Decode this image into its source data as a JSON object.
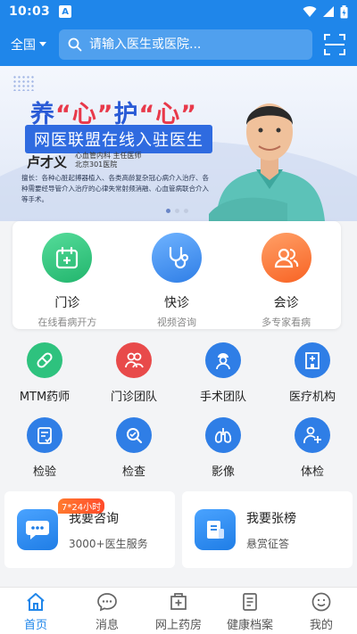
{
  "status": {
    "time": "10:03",
    "app_badge": "A"
  },
  "header": {
    "region": "全国",
    "search_placeholder": "请输入医生或医院..."
  },
  "banner": {
    "headline_pre": "养",
    "headline_q1": "“心”",
    "headline_mid": "护",
    "headline_q2": "“心”",
    "subline": "网医联盟在线入驻医生",
    "doctor_name": "卢才义",
    "doctor_title_1": "心血管内科  主任医师",
    "doctor_title_2": "北京301医院",
    "description": "擅长：各种心脏起搏器植入、各类高龄复杂冠心病介入治疗、各种需要经导管介入治疗的心律失常射频消融、心血管病联合介入等手术。",
    "slide_count": 3,
    "active_slide": 1
  },
  "quick_services": [
    {
      "title": "门诊",
      "sub": "在线看病开方",
      "icon": "calendar-plus-icon",
      "color": "#2ec27e"
    },
    {
      "title": "快诊",
      "sub": "视频咨询",
      "icon": "stethoscope-icon",
      "color": "#2f8bee"
    },
    {
      "title": "会诊",
      "sub": "多专家看病",
      "icon": "group-icon",
      "color": "#ff7a3c"
    }
  ],
  "functions": [
    {
      "label": "MTM药师",
      "icon": "pill-icon",
      "color": "#2ec27e"
    },
    {
      "label": "门诊团队",
      "icon": "team-icon",
      "color": "#e84a4a"
    },
    {
      "label": "手术团队",
      "icon": "surgeon-icon",
      "color": "#2f7ee6"
    },
    {
      "label": "医疗机构",
      "icon": "hospital-icon",
      "color": "#2f7ee6"
    },
    {
      "label": "检验",
      "icon": "clipboard-check-icon",
      "color": "#2f7ee6"
    },
    {
      "label": "检查",
      "icon": "magnifier-icon",
      "color": "#2f7ee6"
    },
    {
      "label": "影像",
      "icon": "lungs-icon",
      "color": "#2f7ee6"
    },
    {
      "label": "体检",
      "icon": "checkup-icon",
      "color": "#2f7ee6"
    }
  ],
  "promos": [
    {
      "title": "我要咨询",
      "sub": "3000+医生服务",
      "tag": "7*24小时",
      "icon": "chat-bubble-icon"
    },
    {
      "title": "我要张榜",
      "sub": "悬赏征答",
      "icon": "notice-board-icon"
    }
  ],
  "tabs": [
    {
      "label": "首页",
      "icon": "home-icon",
      "active": true
    },
    {
      "label": "消息",
      "icon": "message-icon",
      "active": false
    },
    {
      "label": "网上药房",
      "icon": "pharmacy-icon",
      "active": false
    },
    {
      "label": "健康档案",
      "icon": "record-icon",
      "active": false
    },
    {
      "label": "我的",
      "icon": "profile-icon",
      "active": false
    }
  ],
  "colors": {
    "brand": "#1f86ea",
    "active_tab": "#1f86ea",
    "tag": "#ff5a2c"
  }
}
